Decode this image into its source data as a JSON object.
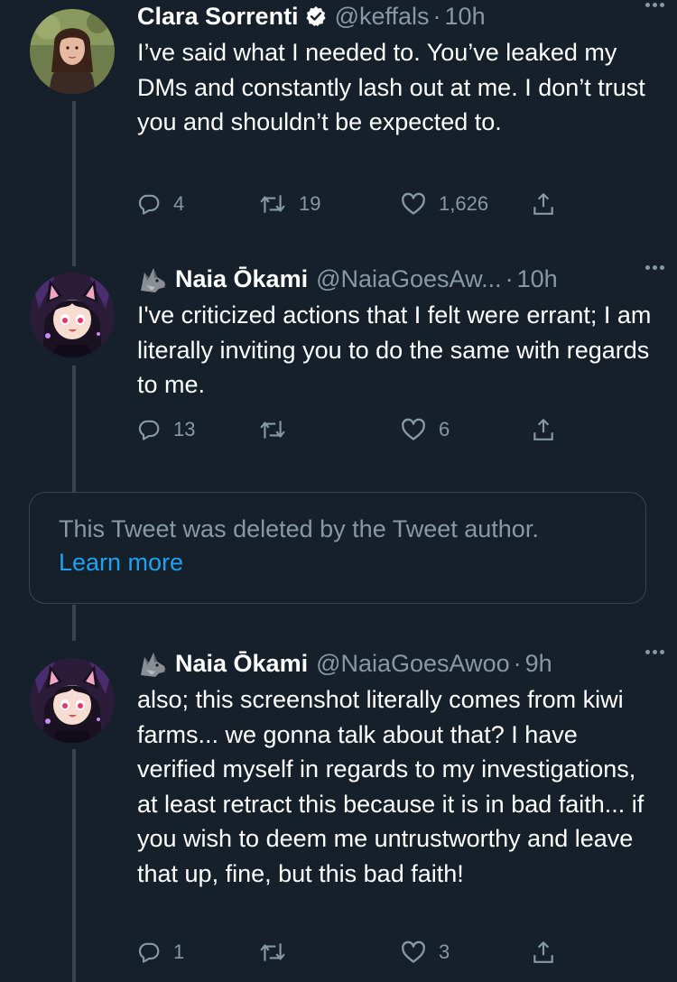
{
  "tweets": [
    {
      "name": "Clara Sorrenti",
      "verified": true,
      "handle": "@keffals",
      "time": "10h",
      "text": "I’ve said what I needed to. You’ve leaked my DMs and constantly lash out at me. I don’t trust you and shouldn’t be expected to.",
      "replies": "4",
      "retweets": "19",
      "likes": "1,626"
    },
    {
      "name": "Naia Ōkami",
      "emoji": "wolf-emoji",
      "handle": "@NaiaGoesAw...",
      "time": "10h",
      "text": "I've criticized actions that I felt were errant; I am literally inviting you to do the same with regards to me.",
      "replies": "13",
      "retweets": "",
      "likes": "6"
    },
    {
      "name": "Naia Ōkami",
      "emoji": "wolf-emoji",
      "handle": "@NaiaGoesAwoo",
      "time": "9h",
      "text": "also; this screenshot literally comes from kiwi farms... we gonna talk about that? I have verified myself in regards to my investigations, at least retract this because it is in bad faith... if you wish to deem me untrustworthy and leave that up, fine, but this bad faith!",
      "replies": "1",
      "retweets": "",
      "likes": "3"
    }
  ],
  "deleted_notice": {
    "text": "This Tweet was deleted by the Tweet author.",
    "link": "Learn more"
  },
  "colors": {
    "background": "#15202b",
    "secondary_text": "#8899a6",
    "accent": "#1da1f2",
    "border": "#38444d"
  }
}
